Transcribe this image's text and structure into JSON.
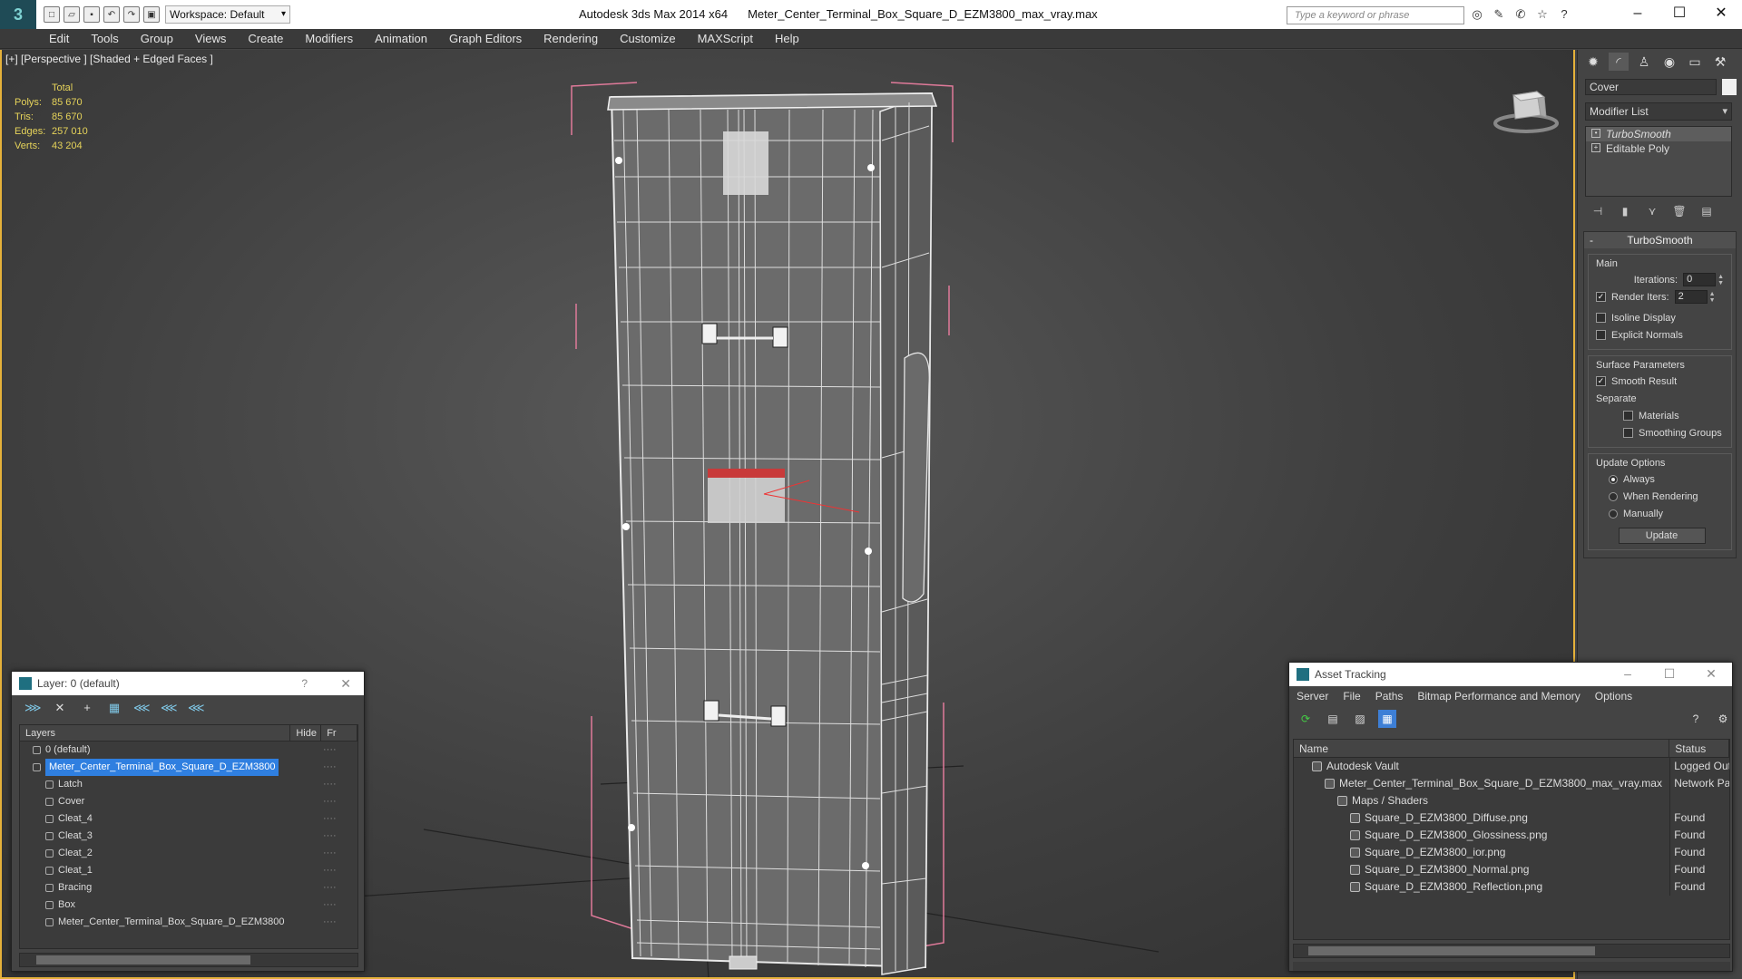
{
  "titlebar": {
    "workspace": "Workspace: Default",
    "app_name": "Autodesk 3ds Max  2014 x64",
    "file_name": "Meter_Center_Terminal_Box_Square_D_EZM3800_max_vray.max",
    "search_placeholder": "Type a keyword or phrase"
  },
  "menu": [
    "Edit",
    "Tools",
    "Group",
    "Views",
    "Create",
    "Modifiers",
    "Animation",
    "Graph Editors",
    "Rendering",
    "Customize",
    "MAXScript",
    "Help"
  ],
  "viewport": {
    "label": "[+] [Perspective ] [Shaded + Edged Faces ]",
    "stats": {
      "header": "Total",
      "polys_label": "Polys:",
      "polys": "85 670",
      "tris_label": "Tris:",
      "tris": "85 670",
      "edges_label": "Edges:",
      "edges": "257 010",
      "verts_label": "Verts:",
      "verts": "43 204"
    }
  },
  "command_panel": {
    "object_name": "Cover",
    "modifier_list": "Modifier List",
    "stack": [
      "TurboSmooth",
      "Editable Poly"
    ],
    "turbosmooth": {
      "title": "TurboSmooth",
      "main_group": "Main",
      "iterations_label": "Iterations:",
      "iterations": "0",
      "render_iters_label": "Render Iters:",
      "render_iters": "2",
      "isoline": "Isoline Display",
      "explicit_normals": "Explicit Normals",
      "surface_group": "Surface Parameters",
      "smooth_result": "Smooth Result",
      "separate": "Separate",
      "materials": "Materials",
      "smoothing_groups": "Smoothing Groups",
      "update_group": "Update Options",
      "always": "Always",
      "when_rendering": "When Rendering",
      "manually": "Manually",
      "update_button": "Update"
    }
  },
  "layer_explorer": {
    "title": "Layer: 0 (default)",
    "help": "?",
    "col_layers": "Layers",
    "col_hide": "Hide",
    "col_freeze": "Fr",
    "rows": [
      {
        "name": "0 (default)",
        "indent": 1
      },
      {
        "name": "Meter_Center_Terminal_Box_Square_D_EZM3800",
        "indent": 1,
        "selected": true
      },
      {
        "name": "Latch",
        "indent": 2
      },
      {
        "name": "Cover",
        "indent": 2
      },
      {
        "name": "Cleat_4",
        "indent": 2
      },
      {
        "name": "Cleat_3",
        "indent": 2
      },
      {
        "name": "Cleat_2",
        "indent": 2
      },
      {
        "name": "Cleat_1",
        "indent": 2
      },
      {
        "name": "Bracing",
        "indent": 2
      },
      {
        "name": "Box",
        "indent": 2
      },
      {
        "name": "Meter_Center_Terminal_Box_Square_D_EZM3800",
        "indent": 2
      }
    ]
  },
  "asset_tracking": {
    "title": "Asset Tracking",
    "menu": [
      "Server",
      "File",
      "Paths",
      "Bitmap Performance and Memory",
      "Options"
    ],
    "col_name": "Name",
    "col_status": "Status",
    "rows": [
      {
        "name": "Autodesk Vault",
        "status": "Logged Out",
        "indent": 1
      },
      {
        "name": "Meter_Center_Terminal_Box_Square_D_EZM3800_max_vray.max",
        "status": "Network Path",
        "indent": 2
      },
      {
        "name": "Maps / Shaders",
        "status": "",
        "indent": 3
      },
      {
        "name": "Square_D_EZM3800_Diffuse.png",
        "status": "Found",
        "indent": 4
      },
      {
        "name": "Square_D_EZM3800_Glossiness.png",
        "status": "Found",
        "indent": 4
      },
      {
        "name": "Square_D_EZM3800_ior.png",
        "status": "Found",
        "indent": 4
      },
      {
        "name": "Square_D_EZM3800_Normal.png",
        "status": "Found",
        "indent": 4
      },
      {
        "name": "Square_D_EZM3800_Reflection.png",
        "status": "Found",
        "indent": 4
      }
    ]
  }
}
